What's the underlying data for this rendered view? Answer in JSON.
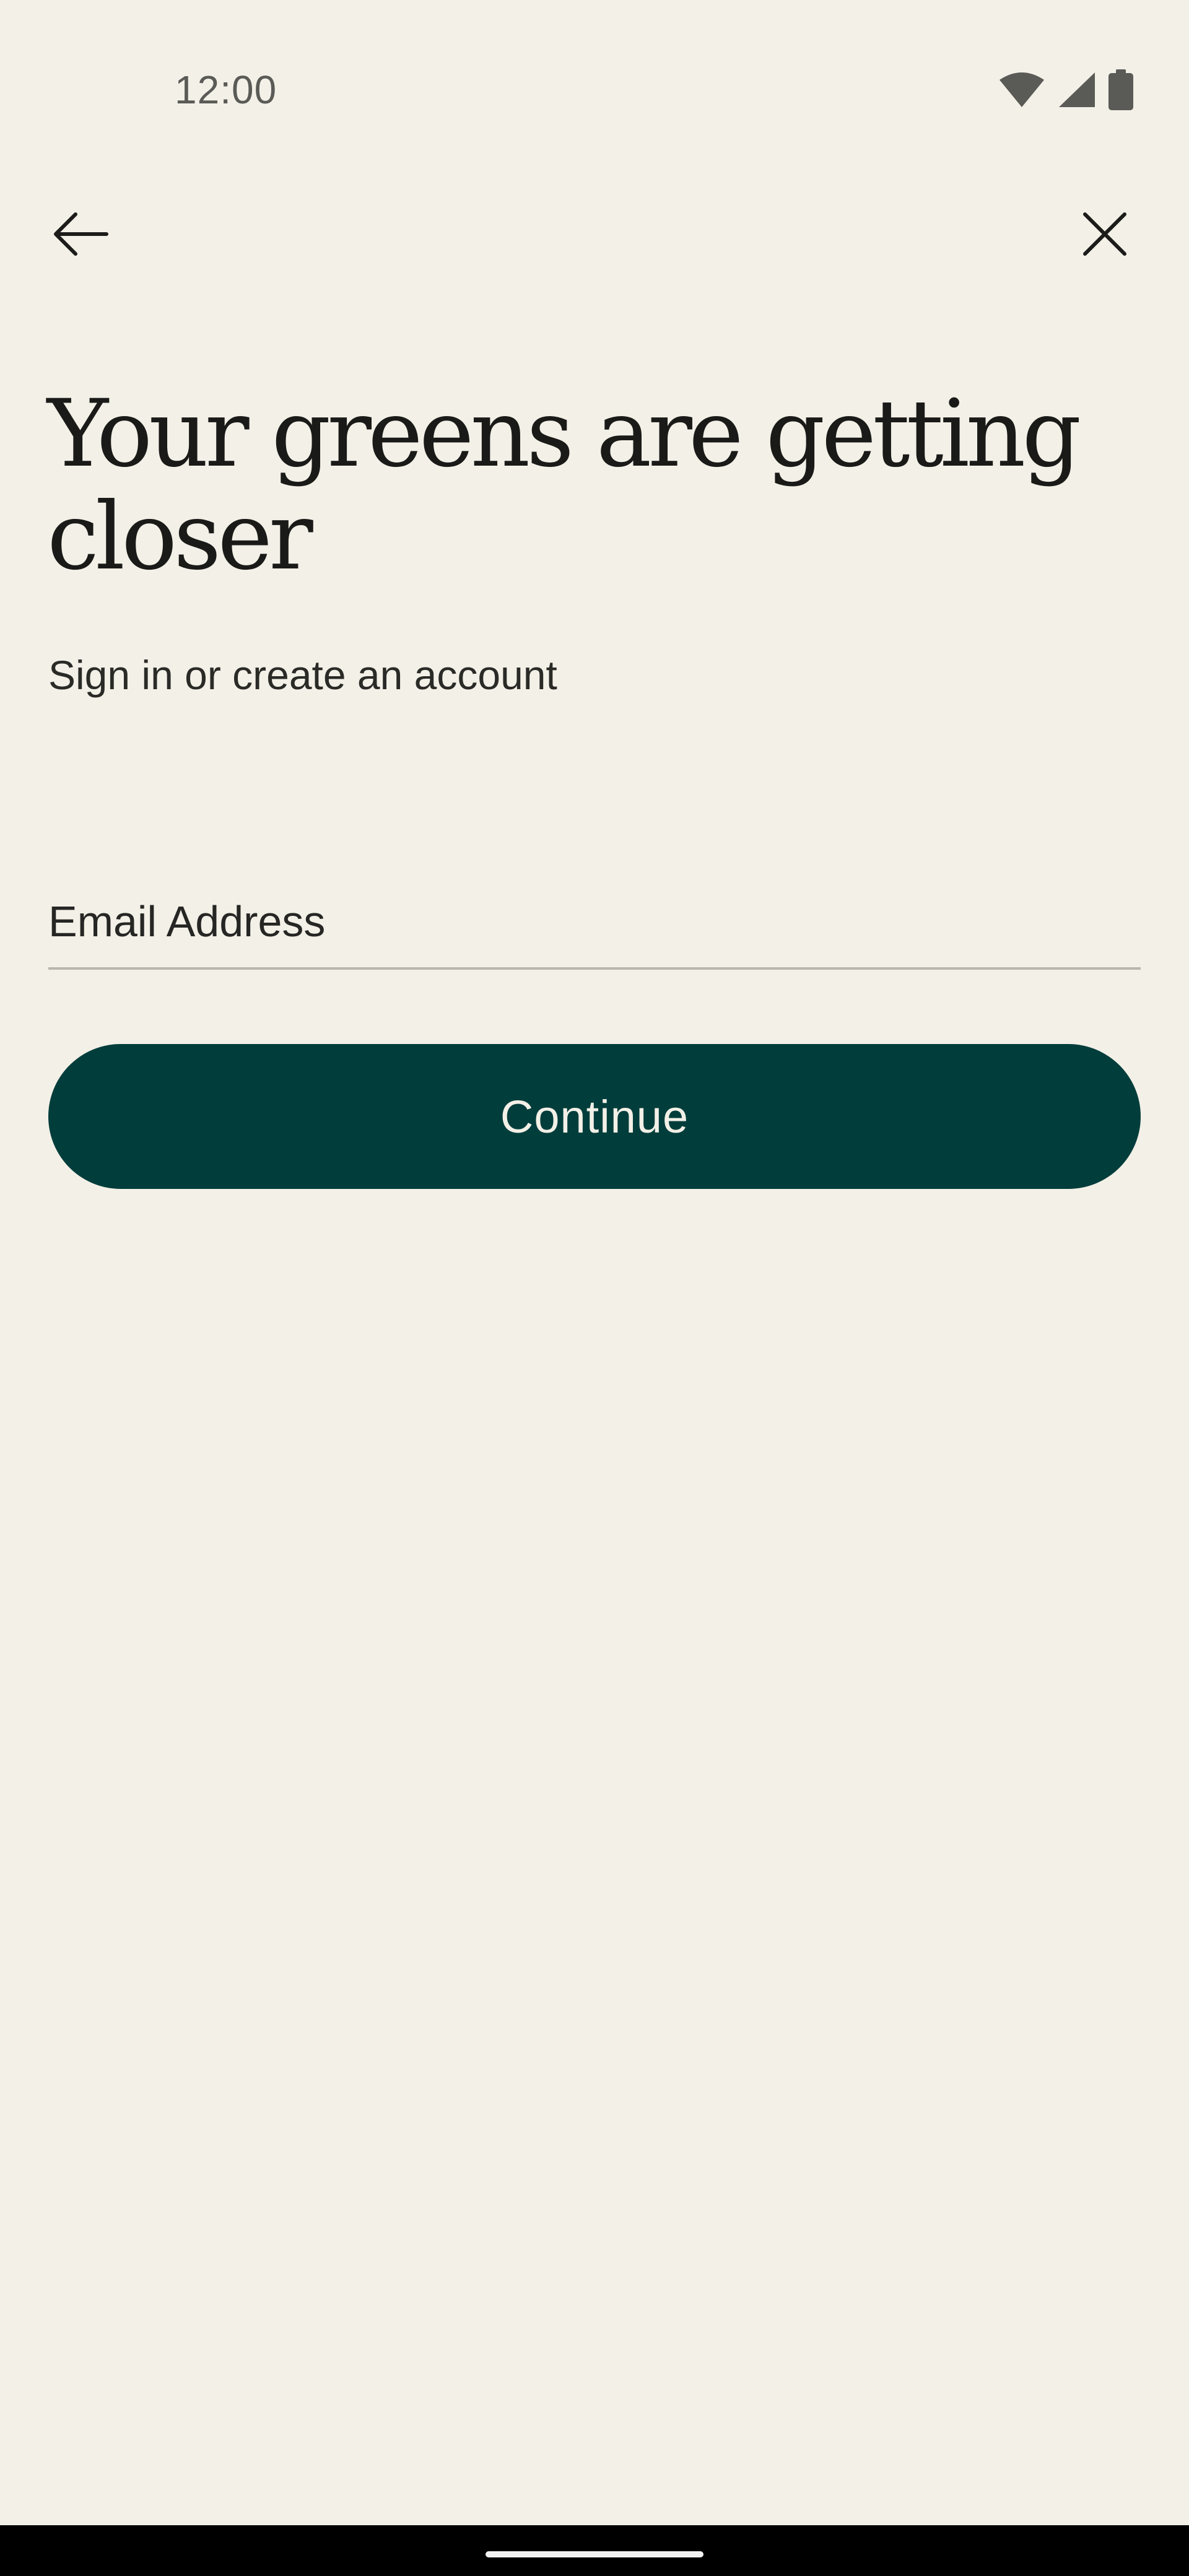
{
  "status_bar": {
    "time": "12:00",
    "icons": [
      "wifi-icon",
      "cellular-signal-icon",
      "battery-icon"
    ]
  },
  "nav": {
    "back_icon": "arrow-left-icon",
    "close_icon": "close-icon"
  },
  "content": {
    "headline": "Your greens are getting closer",
    "subtitle": "Sign in or create an account"
  },
  "form": {
    "email_placeholder": "Email Address",
    "email_value": "",
    "continue_label": "Continue"
  },
  "colors": {
    "background": "#f3f0e7",
    "button": "#003d3b",
    "button_text": "#f3f0e7",
    "text": "#1c1c1a",
    "divider": "#b8b6ae"
  }
}
